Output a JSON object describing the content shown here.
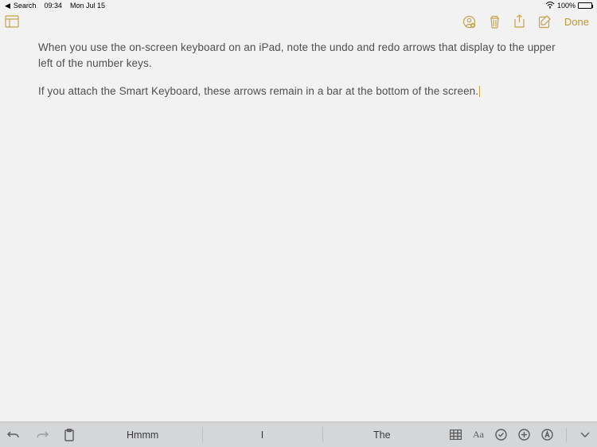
{
  "statusbar": {
    "back_app": "Search",
    "time": "09:34",
    "date": "Mon Jul 15",
    "battery_pct": "100%"
  },
  "toolbar": {
    "done_label": "Done"
  },
  "note": {
    "para1": "When you use the on-screen keyboard on an iPad, note the undo and redo arrows that display to the upper left of the number keys.",
    "para2": "If you attach the Smart Keyboard, these arrows remain in a bar at the bottom of the screen."
  },
  "keyboard_bar": {
    "predictions": [
      "Hmmm",
      "I",
      "The"
    ]
  }
}
